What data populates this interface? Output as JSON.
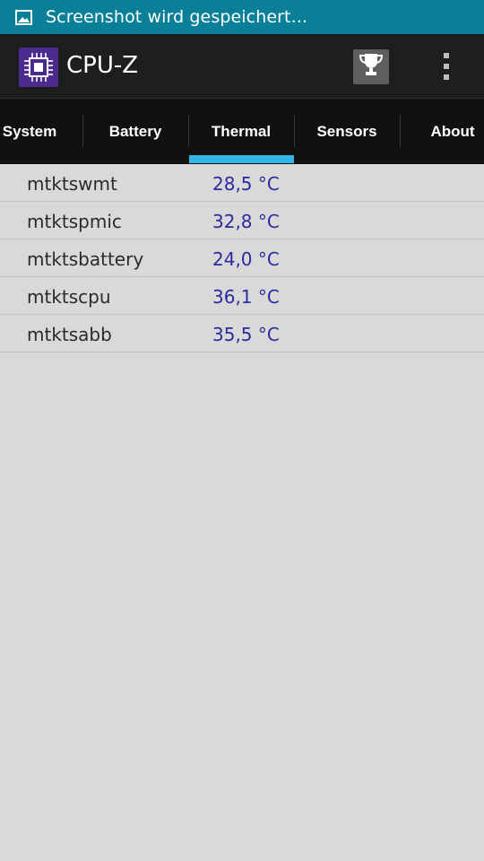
{
  "status_bar": {
    "icon": "image-icon",
    "text": "Screenshot wird gespeichert..."
  },
  "action_bar": {
    "logo_icon": "cpu-chip-icon",
    "title": "CPU-Z",
    "trophy_icon": "trophy-icon",
    "overflow_icon": "overflow-menu-icon"
  },
  "tabs": [
    {
      "label": "System"
    },
    {
      "label": "Battery"
    },
    {
      "label": "Thermal",
      "active": true
    },
    {
      "label": "Sensors"
    },
    {
      "label": "About"
    }
  ],
  "colors": {
    "status_bar": "#0a8098",
    "action_bar": "#1e1e1e",
    "tab_bar": "#111111",
    "tab_indicator": "#33b5e5",
    "value_text": "#2b2aa0",
    "background": "#d9d9d9",
    "logo_bg": "#4d2a8e"
  },
  "thermal": [
    {
      "name": "mtktswmt",
      "value": "28,5 °C"
    },
    {
      "name": "mtktspmic",
      "value": "32,8 °C"
    },
    {
      "name": "mtktsbattery",
      "value": "24,0 °C"
    },
    {
      "name": "mtktscpu",
      "value": "36,1 °C"
    },
    {
      "name": "mtktsabb",
      "value": "35,5 °C"
    }
  ]
}
